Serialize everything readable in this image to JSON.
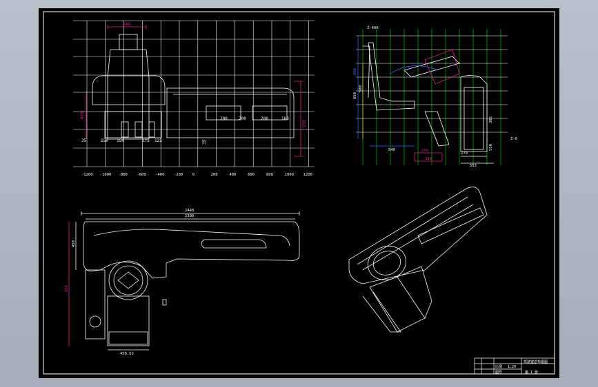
{
  "drawing": {
    "background": "#000000",
    "line_color": "#ffffff",
    "accent_colors": {
      "magenta": "#e0208c",
      "green": "#00e000",
      "blue": "#3060ff",
      "yellow": "#e8e800"
    }
  },
  "front_view": {
    "x_ticks": [
      "-1200",
      "-1000",
      "-800",
      "-600",
      "-400",
      "-200",
      "0",
      "200",
      "400",
      "600",
      "800",
      "1000",
      "1200"
    ],
    "dimensions": {
      "top_width": "140",
      "left_height": "430",
      "right_height": "550",
      "base_1": "150",
      "base_2": "150",
      "base_3": "175",
      "base_4": "125",
      "inner_1": "200",
      "inner_2": "200",
      "inner_3": "200",
      "inner_4": "160",
      "mid_1": "35",
      "mid_2": "35"
    }
  },
  "side_view": {
    "title": "Z-400",
    "dimensions": {
      "left_a": "800",
      "left_b": "650",
      "left_c": "500",
      "bottom_width": "540",
      "red_1": "250",
      "red_2": "300",
      "right_a": "270",
      "right_b": "553",
      "right_c": "385",
      "right_d": "550",
      "far_label": "Z-0"
    }
  },
  "top_view": {
    "dimensions": {
      "overall_width": "2448",
      "inner_width": "2300",
      "left_height": "450",
      "column_height": "950",
      "bottom_width": "450.52"
    }
  },
  "title_block": {
    "title": "驾驶室总布置图",
    "cell_a": "比例",
    "cell_b": "1:20",
    "cell_c": "图号",
    "cell_d": "第 1 张"
  }
}
